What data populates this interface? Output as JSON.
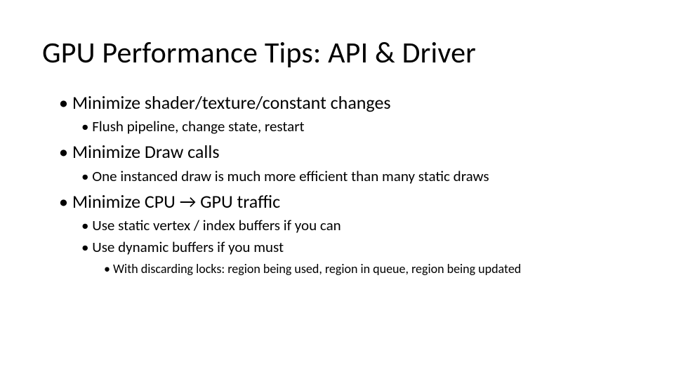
{
  "title": "GPU Performance Tips: API & Driver",
  "bullets": [
    {
      "text": "Minimize shader/texture/constant changes",
      "children": [
        {
          "text": "Flush pipeline, change state, restart"
        }
      ]
    },
    {
      "text": "Minimize Draw calls",
      "children": [
        {
          "text": "One instanced draw is much more efficient than many static draws"
        }
      ]
    },
    {
      "text": "Minimize CPU → GPU traffic",
      "children": [
        {
          "text": "Use static vertex / index buffers if you can"
        },
        {
          "text": "Use dynamic buffers if you must",
          "children": [
            {
              "text": "With discarding locks: region being used, region in queue, region being updated"
            }
          ]
        }
      ]
    }
  ]
}
